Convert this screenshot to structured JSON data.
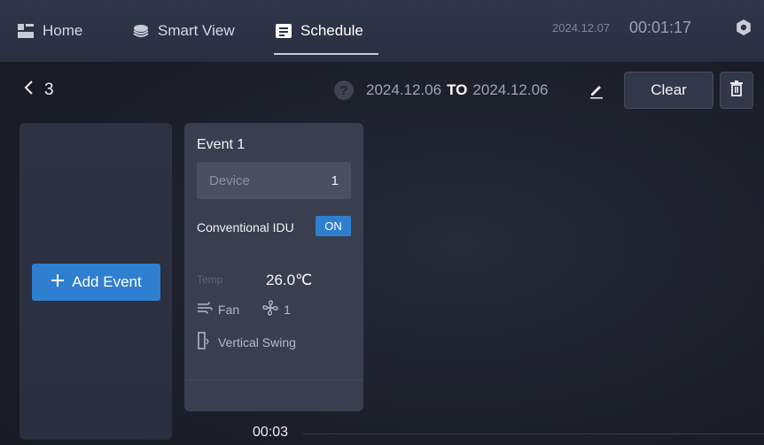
{
  "nav": {
    "tabs": [
      {
        "label": "Home",
        "icon": "home-icon"
      },
      {
        "label": "Smart View",
        "icon": "layers-icon"
      },
      {
        "label": "Schedule",
        "icon": "calendar-icon",
        "active": true
      }
    ],
    "date": "2024.12.07",
    "time": "00:01:17"
  },
  "header": {
    "back_count": "3",
    "range_start": "2024.12.06",
    "range_to": "TO",
    "range_end": "2024.12.06",
    "clear_label": "Clear"
  },
  "add_event": {
    "label": "Add Event"
  },
  "event": {
    "title": "Event 1",
    "device_label": "Device",
    "device_count": "1",
    "idu_name": "Conventional IDU",
    "state": "ON",
    "temp_label": "Temp",
    "temp_value": "26.0℃",
    "fan_label": "Fan",
    "fan_speed": "1",
    "swing_label": "Vertical Swing"
  },
  "timeline": {
    "time": "00:03"
  },
  "colors": {
    "accent": "#2f7fd0",
    "background": "#1c1f2a",
    "topbar": "#2d3245",
    "card": "#3a3f50"
  }
}
